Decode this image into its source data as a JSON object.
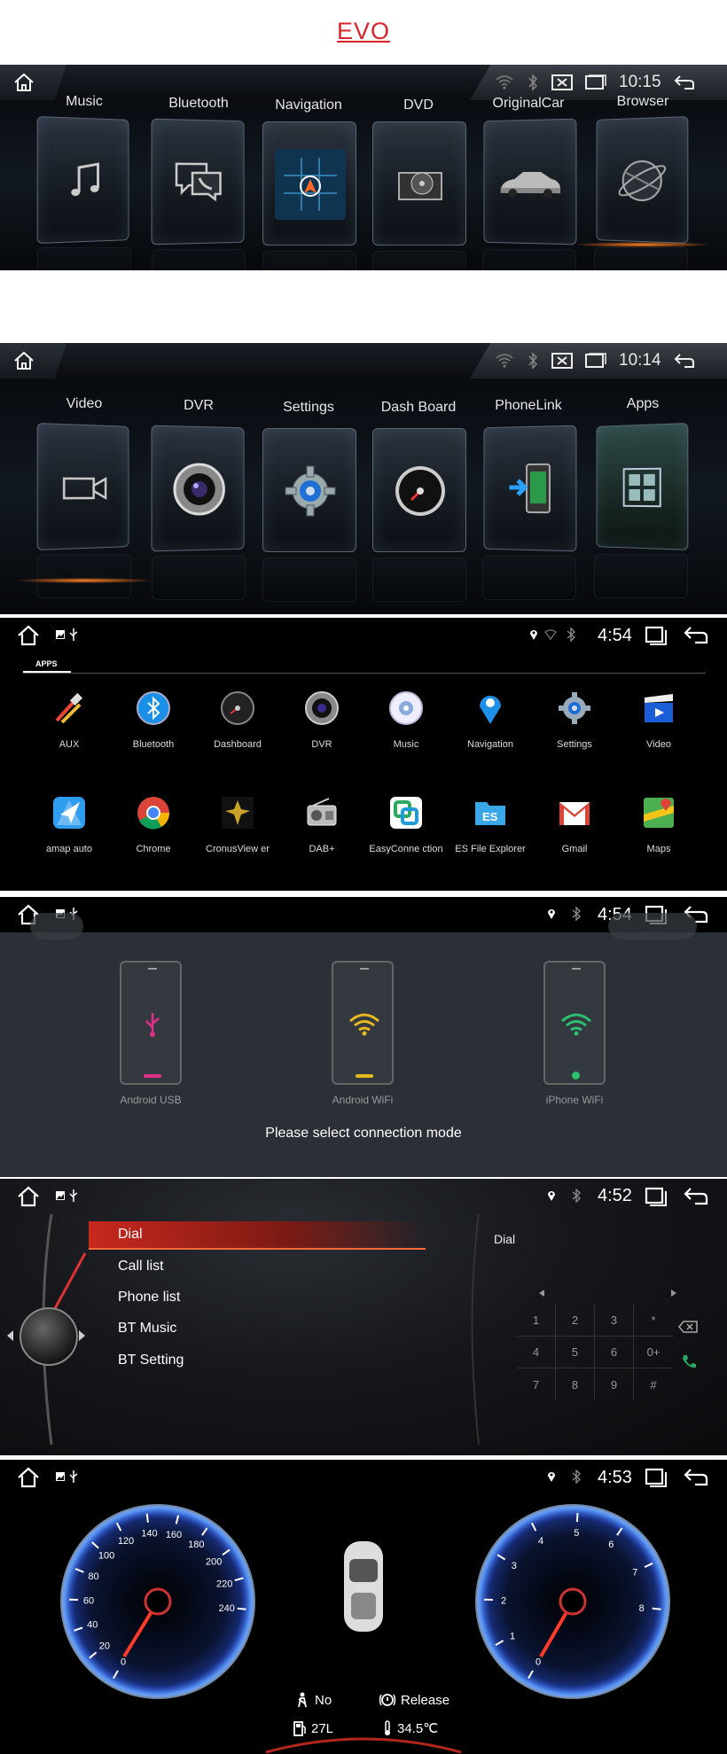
{
  "page_title": "EVO",
  "evo1": {
    "time": "10:15",
    "tiles": [
      "Music",
      "Bluetooth",
      "Navigation",
      "DVD",
      "OriginalCar",
      "Browser"
    ]
  },
  "evo2": {
    "time": "10:14",
    "tiles": [
      "Video",
      "DVR",
      "Settings",
      "Dash Board",
      "PhoneLink",
      "Apps"
    ]
  },
  "apps_panel": {
    "time": "4:54",
    "tab": "APPS",
    "row1": [
      "AUX",
      "Bluetooth",
      "Dashboard",
      "DVR",
      "Music",
      "Navigation",
      "Settings",
      "Video"
    ],
    "row2": [
      "amap auto",
      "Chrome",
      "CronusView er",
      "DAB+",
      "EasyConne ction",
      "ES File Explorer",
      "Gmail",
      "Maps"
    ]
  },
  "phonelink_panel": {
    "time": "4:54",
    "modes": [
      "Android USB",
      "Android WiFi",
      "iPhone WiFi"
    ],
    "prompt": "Please select connection mode"
  },
  "bt_panel": {
    "time": "4:52",
    "menu": [
      "Dial",
      "Call list",
      "Phone list",
      "BT Music",
      "BT Setting"
    ],
    "dial_title": "Dial",
    "keys": [
      "1",
      "2",
      "3",
      "*",
      "4",
      "5",
      "6",
      "0+",
      "7",
      "8",
      "9",
      "#"
    ]
  },
  "dash_panel": {
    "time": "4:53",
    "speed_ticks": [
      "0",
      "20",
      "40",
      "60",
      "80",
      "100",
      "120",
      "140",
      "160",
      "180",
      "200",
      "220",
      "240"
    ],
    "rpm_ticks": [
      "0",
      "1",
      "2",
      "3",
      "4",
      "5",
      "6",
      "7",
      "8"
    ],
    "seatbelt": "No",
    "brake": "Release",
    "fuel": "27L",
    "temp": "34.5℃"
  },
  "colors": {
    "accent_red": "#d9242b",
    "orange_glow": "#ff8a2a"
  }
}
